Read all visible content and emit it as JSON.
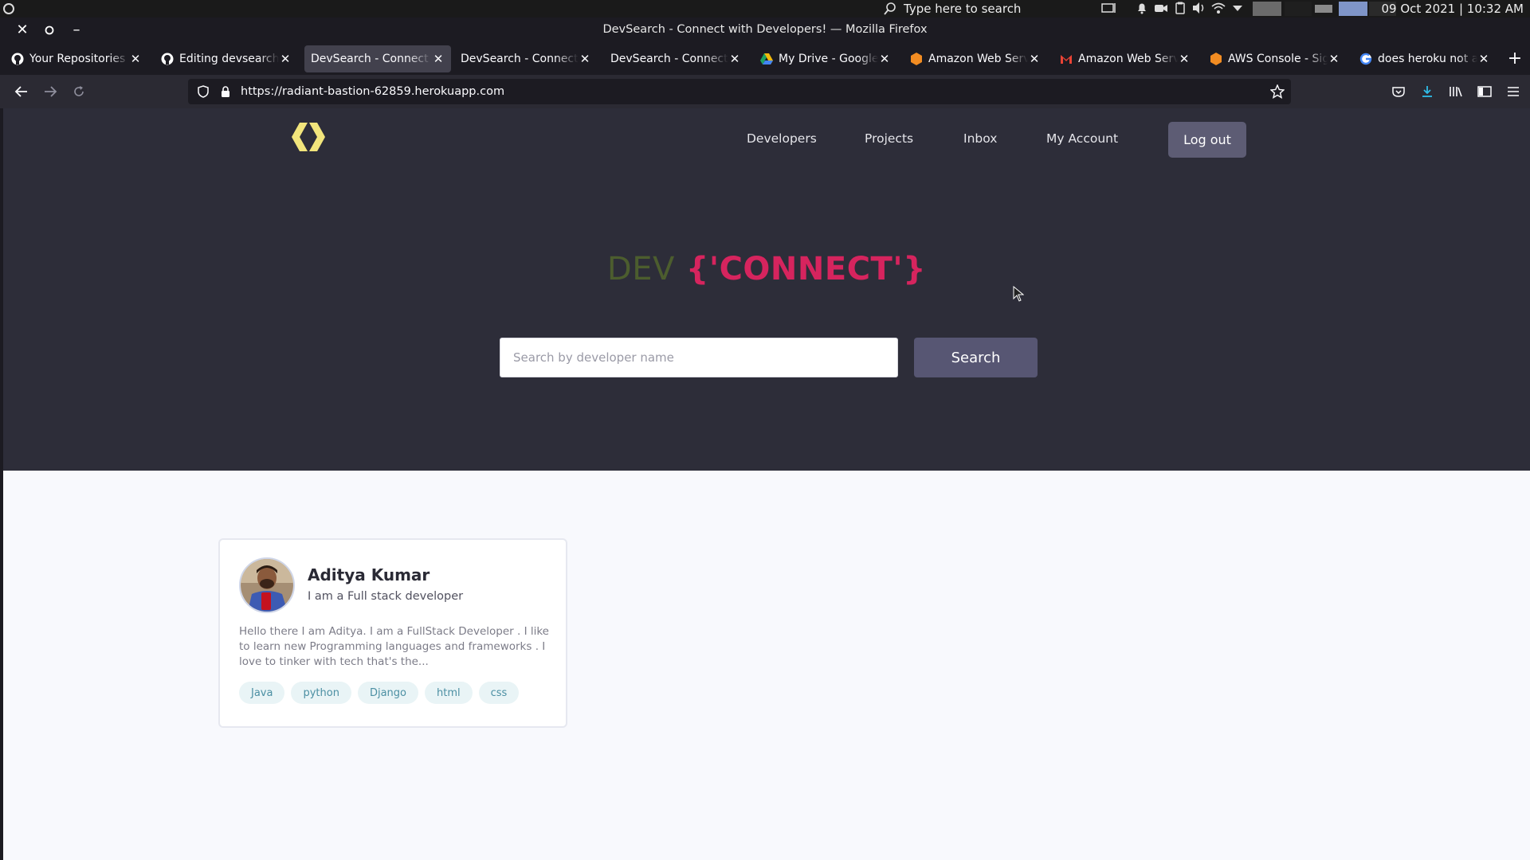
{
  "system": {
    "search_placeholder": "Type here to search",
    "clock": "09 Oct 2021 | 10:32 AM"
  },
  "window": {
    "title": "DevSearch - Connect with Developers! — Mozilla Firefox"
  },
  "tabs": [
    {
      "label": "Your Repositories",
      "icon": "github-icon"
    },
    {
      "label": "Editing devsearch/README",
      "icon": "github-icon"
    },
    {
      "label": "DevSearch - Connect with Developers!",
      "icon": "none",
      "active": true
    },
    {
      "label": "DevSearch - Connect with Developers!",
      "icon": "none"
    },
    {
      "label": "DevSearch - Connect with Developers!",
      "icon": "none"
    },
    {
      "label": "My Drive - Google Drive",
      "icon": "google-drive-icon"
    },
    {
      "label": "Amazon Web Services",
      "icon": "aws-icon"
    },
    {
      "label": "Amazon Web Services",
      "icon": "gmail-icon"
    },
    {
      "label": "AWS Console - Signup",
      "icon": "aws-icon"
    },
    {
      "label": "does heroku not allow",
      "icon": "google-icon"
    }
  ],
  "urlbar": {
    "url": "https://radiant-bastion-62859.herokuapp.com"
  },
  "site": {
    "nav": {
      "developers": "Developers",
      "projects": "Projects",
      "inbox": "Inbox",
      "my_account": "My Account",
      "logout": "Log out"
    },
    "brand": {
      "prefix": "DEV",
      "highlight": "{'CONNECT'}"
    },
    "search": {
      "placeholder": "Search by developer name",
      "button": "Search"
    },
    "colors": {
      "hero_bg": "#2d2d39",
      "brand_prefix": "#4c5d2e",
      "brand_highlight": "#d6245e",
      "button_bg": "#575673",
      "tag_bg": "#e9f4f6",
      "tag_text": "#4b8fa3"
    }
  },
  "developers": [
    {
      "name": "Aditya Kumar",
      "title": "I am a Full stack developer",
      "bio": "Hello there I am Aditya. I am a FullStack Developer . I like to learn new Programming languages and frameworks . I love to tinker with tech that's the...",
      "tags": [
        "Java",
        "python",
        "Django",
        "html",
        "css"
      ]
    }
  ]
}
